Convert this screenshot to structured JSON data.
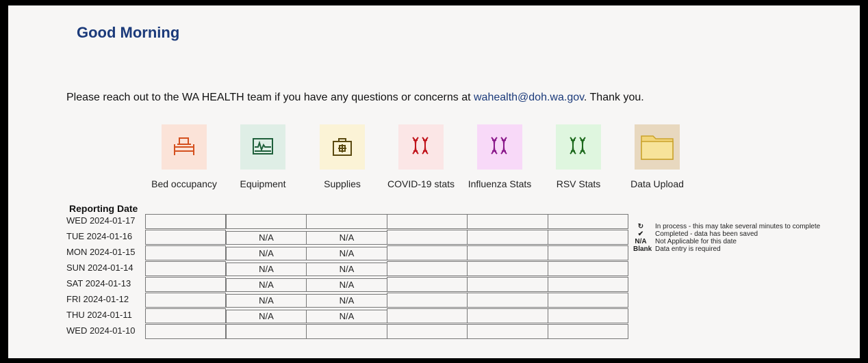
{
  "greeting": "Good Morning",
  "notice": {
    "before": "Please reach out to the WA HEALTH team if you have any questions or concerns at ",
    "email": "wahealth@doh.wa.gov",
    "after": ". Thank you."
  },
  "tiles": [
    {
      "label": "Bed occupancy",
      "icon": "bed-icon",
      "bg": "#fbe3d8",
      "color": "#d4501e"
    },
    {
      "label": "Equipment",
      "icon": "monitor-icon",
      "bg": "#dfeee6",
      "color": "#1e5f3a"
    },
    {
      "label": "Supplies",
      "icon": "first-aid-kit-icon",
      "bg": "#fbf3d6",
      "color": "#5a4a10"
    },
    {
      "label": "COVID-19 stats",
      "icon": "dna-icon",
      "bg": "#fbe6e6",
      "color": "#c0141c"
    },
    {
      "label": "Influenza Stats",
      "icon": "dna-icon",
      "bg": "#f8d9f8",
      "color": "#8b1a8b"
    },
    {
      "label": "RSV Stats",
      "icon": "dna-icon",
      "bg": "#dff6df",
      "color": "#1e6a1e"
    },
    {
      "label": "Data Upload",
      "icon": "folder-icon",
      "bg": "#e8d8bf",
      "color": "#d9b23a"
    }
  ],
  "reporting_title": "Reporting Date",
  "rows": [
    {
      "date": "WED 2024-01-17",
      "cells": [
        "",
        "",
        "",
        "",
        "",
        ""
      ]
    },
    {
      "date": "TUE 2024-01-16",
      "cells": [
        "",
        "N/A",
        "N/A",
        "",
        "",
        ""
      ]
    },
    {
      "date": "MON 2024-01-15",
      "cells": [
        "",
        "N/A",
        "N/A",
        "",
        "",
        ""
      ]
    },
    {
      "date": "SUN 2024-01-14",
      "cells": [
        "",
        "N/A",
        "N/A",
        "",
        "",
        ""
      ]
    },
    {
      "date": "SAT 2024-01-13",
      "cells": [
        "",
        "N/A",
        "N/A",
        "",
        "",
        ""
      ]
    },
    {
      "date": "FRI 2024-01-12",
      "cells": [
        "",
        "N/A",
        "N/A",
        "",
        "",
        ""
      ]
    },
    {
      "date": "THU 2024-01-11",
      "cells": [
        "",
        "N/A",
        "N/A",
        "",
        "",
        ""
      ]
    },
    {
      "date": "WED 2024-01-10",
      "cells": [
        "",
        "",
        "",
        "",
        "",
        ""
      ]
    }
  ],
  "legend": [
    {
      "symbol": "↻",
      "icon": "refresh-icon",
      "text": "In process - this may take several minutes to complete"
    },
    {
      "symbol": "✔",
      "icon": "check-icon",
      "text": "Completed - data has been saved"
    },
    {
      "symbol": "N/A",
      "text": "Not Applicable for this date"
    },
    {
      "symbol": "Blank",
      "text": "Data entry is required"
    }
  ]
}
